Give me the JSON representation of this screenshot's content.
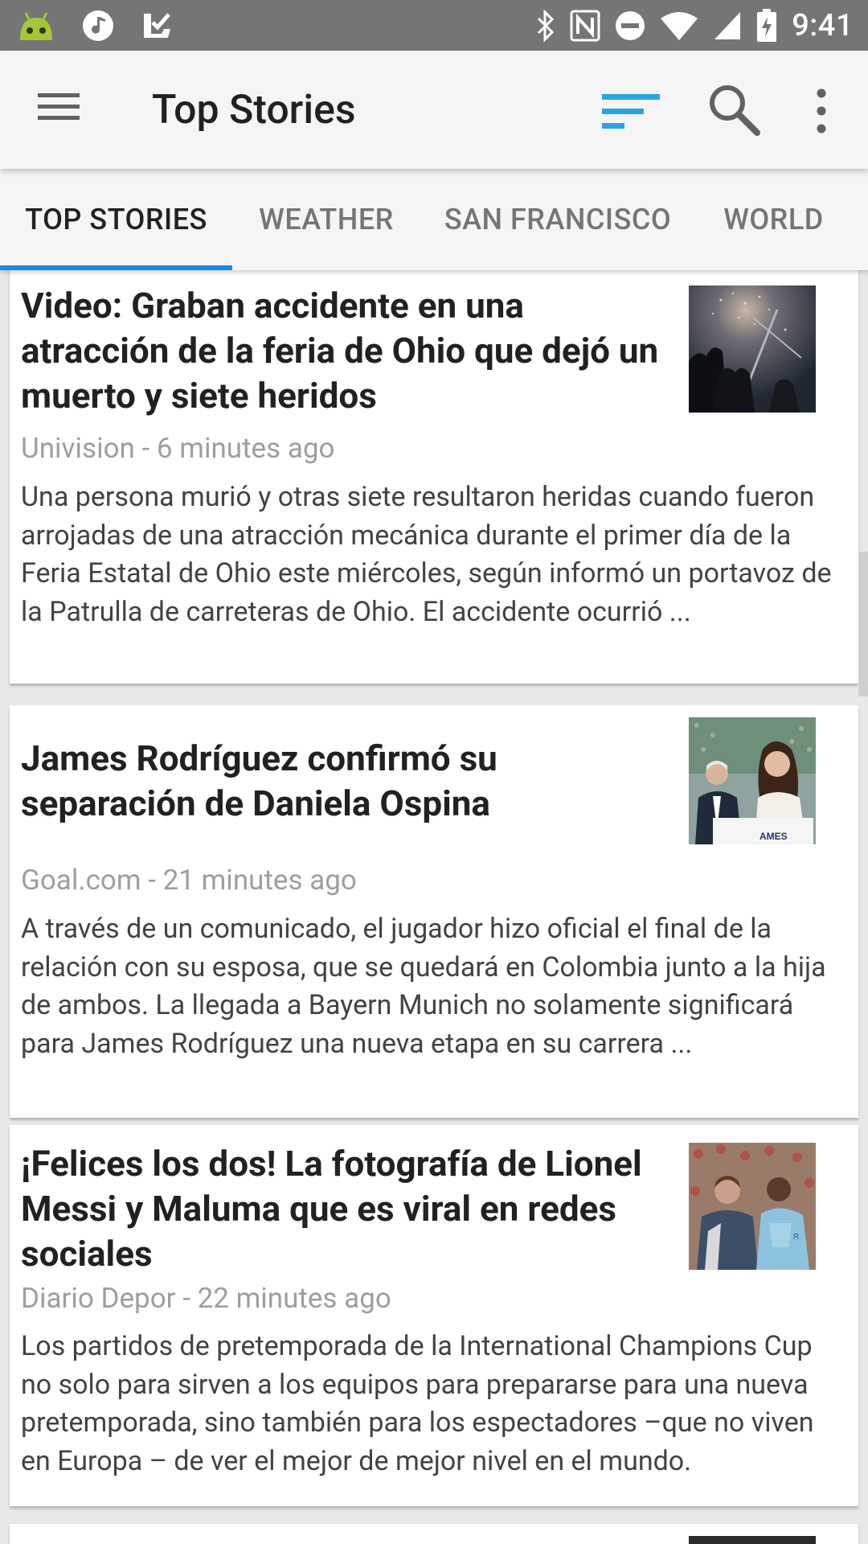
{
  "status_bar": {
    "time": "9:41",
    "left_icons": [
      "android-icon",
      "music-icon",
      "inbox-check-icon"
    ],
    "right_icons": [
      "bluetooth-icon",
      "nfc-icon",
      "do-not-disturb-icon",
      "wifi-icon",
      "signal-icon",
      "battery-icon"
    ]
  },
  "app_bar": {
    "title": "Top Stories",
    "accent_color": "#29a4e3"
  },
  "tabs": [
    {
      "label": "TOP STORIES",
      "active": true
    },
    {
      "label": "WEATHER",
      "active": false
    },
    {
      "label": "SAN FRANCISCO",
      "active": false
    },
    {
      "label": "WORLD",
      "active": false
    }
  ],
  "stories": [
    {
      "headline": "Video: Graban accidente en una atracción de la feria de Ohio que dejó un muerto y siete heridos",
      "source_time": "Univision - 6 minutes ago",
      "snippet": "Una persona murió y otras siete resultaron heridas cuando fueron arrojadas de una atracción mecánica durante el primer día de la Feria Estatal de Ohio este miércoles, según informó un portavoz de la Patrulla de carreteras de Ohio. El accidente ocurrió ..."
    },
    {
      "headline": "James Rodríguez confirmó su separación de Daniela Ospina",
      "source_time": "Goal.com - 21 minutes ago",
      "snippet": "A través de un comunicado, el jugador hizo oficial el final de la relación con su esposa, que se quedará en Colombia junto a la hija de ambos. La llegada a Bayern Munich no solamente significará para James Rodríguez una nueva etapa en su carrera ..."
    },
    {
      "headline": "¡Felices los dos! La fotografía de Lionel Messi y Maluma que es viral en redes sociales",
      "source_time": "Diario Depor - 22 minutes ago",
      "snippet": "Los partidos de pretemporada de la International Champions Cup no solo para sirven a los equipos para prepararse para una nueva pretemporada, sino también para los espectadores –que no viven en Europa – de ver el mejor de mejor nivel en el mundo."
    }
  ]
}
